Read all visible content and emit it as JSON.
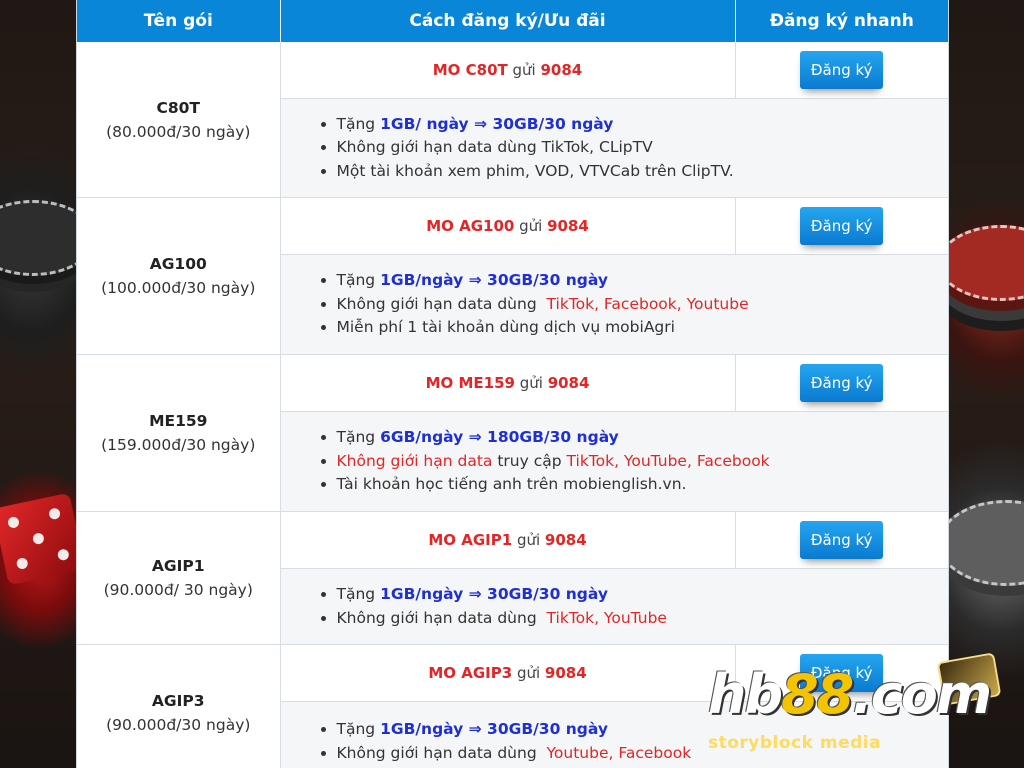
{
  "table": {
    "headers": [
      "Tên gói",
      "Cách đăng ký/Ưu đãi",
      "Đăng ký nhanh"
    ],
    "button_label": "Đăng ký",
    "rows": [
      {
        "code": "C80T",
        "price": "(80.000đ/30 ngày)",
        "cmd_prefix": "MO C80T",
        "cmd_mid": " gửi ",
        "cmd_number": "9084",
        "benefits": [
          [
            {
              "t": "Tặng "
            },
            {
              "t": "1GB/ ngày ⇒ 30GB/30 ngày",
              "c": "blue"
            }
          ],
          [
            {
              "t": "Không giới hạn data dùng TikTok, CLipTV"
            }
          ],
          [
            {
              "t": "Một tài khoản xem phim, VOD, VTVCab trên ClipTV."
            }
          ]
        ]
      },
      {
        "code": "AG100",
        "price": "(100.000đ/30 ngày)",
        "cmd_prefix": "MO AG100",
        "cmd_mid": " gửi ",
        "cmd_number": "9084",
        "benefits": [
          [
            {
              "t": "Tặng "
            },
            {
              "t": "1GB/ngày ⇒ 30GB/30 ngày",
              "c": "blue"
            }
          ],
          [
            {
              "t": "Không giới hạn data dùng  "
            },
            {
              "t": "TikTok, Facebook, Youtube",
              "c": "red"
            }
          ],
          [
            {
              "t": "Miễn phí 1 tài khoản dùng dịch vụ mobiAgri"
            }
          ]
        ]
      },
      {
        "code": "ME159",
        "price": "(159.000đ/30 ngày)",
        "cmd_prefix": "MO ME159",
        "cmd_mid": " gửi ",
        "cmd_number": "9084",
        "benefits": [
          [
            {
              "t": "Tặng "
            },
            {
              "t": "6GB/ngày ⇒ 180GB/30 ngày",
              "c": "blue"
            }
          ],
          [
            {
              "t": "Không giới hạn data",
              "c": "red"
            },
            {
              "t": " truy cập "
            },
            {
              "t": "TikTok, YouTube, Facebook",
              "c": "red"
            }
          ],
          [
            {
              "t": "Tài khoản học tiếng anh trên mobienglish.vn."
            }
          ]
        ]
      },
      {
        "code": "AGIP1",
        "price": "(90.000đ/ 30 ngày)",
        "cmd_prefix": "MO AGIP1",
        "cmd_mid": " gửi ",
        "cmd_number": "9084",
        "benefits": [
          [
            {
              "t": "Tặng "
            },
            {
              "t": "1GB/ngày ⇒ 30GB/30 ngày",
              "c": "blue"
            }
          ],
          [
            {
              "t": "Không giới hạn data dùng  "
            },
            {
              "t": "TikTok, YouTube",
              "c": "red"
            }
          ]
        ]
      },
      {
        "code": "AGIP3",
        "price": "(90.000đ/30 ngày)",
        "cmd_prefix": "MO AGIP3",
        "cmd_mid": " gửi ",
        "cmd_number": "9084",
        "benefits": [
          [
            {
              "t": "Tặng "
            },
            {
              "t": "1GB/ngày ⇒ 30GB/30 ngày",
              "c": "blue"
            }
          ],
          [
            {
              "t": "Không giới hạn data dùng  "
            },
            {
              "t": "Youtube, Facebook",
              "c": "red"
            }
          ]
        ]
      }
    ]
  },
  "watermark": {
    "logo_prefix": "hb",
    "logo_accent": "88",
    "logo_suffix": ".com",
    "caption": "storyblock media"
  }
}
